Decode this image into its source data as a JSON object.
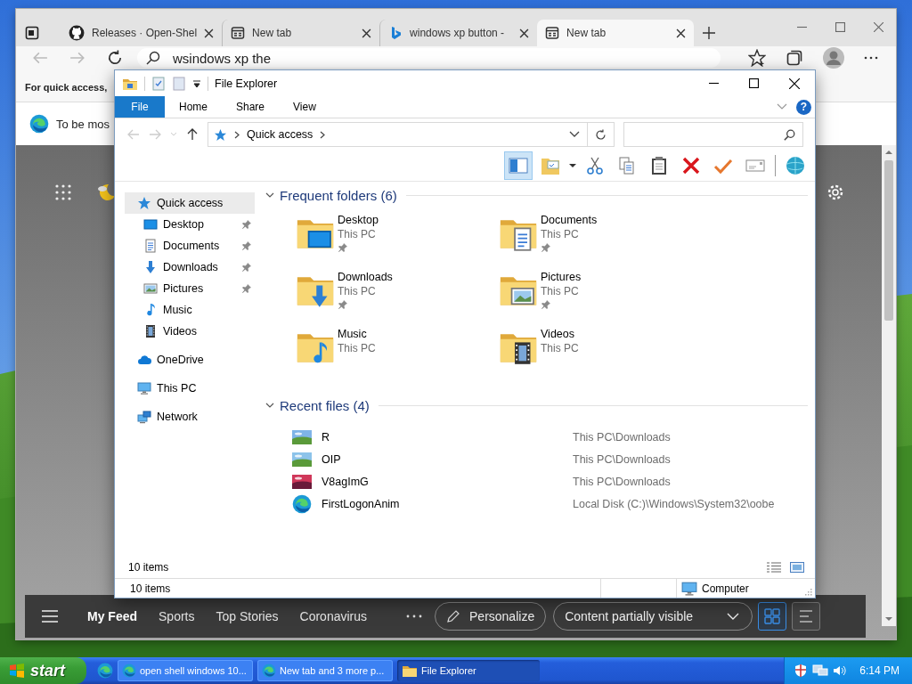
{
  "browser": {
    "tabs": [
      {
        "title": "Releases · Open-Shel",
        "kind": "github",
        "selected": false
      },
      {
        "title": "New tab",
        "kind": "page",
        "selected": false
      },
      {
        "title": "windows xp button -",
        "kind": "bing",
        "selected": false
      },
      {
        "title": "New tab",
        "kind": "page",
        "selected": true
      }
    ],
    "address": "wsindows xp the",
    "favorites_bar": "For quick access,",
    "notification": "To be mos",
    "feed_tabs": [
      {
        "label": "My Feed",
        "selected": true
      },
      {
        "label": "Sports",
        "selected": false
      },
      {
        "label": "Top Stories",
        "selected": false
      },
      {
        "label": "Coronavirus",
        "selected": false
      }
    ],
    "personalize": "Personalize",
    "content_filter": "Content partially visible",
    "layout_buttons": [
      {
        "kind": "grid",
        "selected": true
      },
      {
        "kind": "list",
        "selected": false
      }
    ]
  },
  "explorer": {
    "title": "File Explorer",
    "ribbon_tabs": [
      {
        "label": "File",
        "selected": true
      },
      {
        "label": "Home",
        "selected": false
      },
      {
        "label": "Share",
        "selected": false
      },
      {
        "label": "View",
        "selected": false
      }
    ],
    "help": "?",
    "breadcrumb": "Quick access",
    "toolbar": [
      {
        "kind": "pane",
        "selected": true
      },
      {
        "kind": "folder",
        "selected": false
      },
      {
        "kind": "caret",
        "selected": false
      },
      {
        "kind": "cut",
        "selected": false
      },
      {
        "kind": "copy",
        "selected": false
      },
      {
        "kind": "paste",
        "selected": false
      },
      {
        "kind": "delete",
        "selected": false
      },
      {
        "kind": "rename",
        "selected": false
      },
      {
        "kind": "mail",
        "selected": false
      },
      {
        "kind": "globe",
        "selected": false
      }
    ],
    "nav": [
      {
        "label": "Quick access",
        "kind": "star",
        "selected": true,
        "children": [
          {
            "label": "Desktop",
            "kind": "desktop",
            "pinned": true,
            "selected": false
          },
          {
            "label": "Documents",
            "kind": "documents",
            "pinned": true,
            "selected": false
          },
          {
            "label": "Downloads",
            "kind": "downloads",
            "pinned": true,
            "selected": false
          },
          {
            "label": "Pictures",
            "kind": "pictures",
            "pinned": true,
            "selected": false
          },
          {
            "label": "Music",
            "kind": "music",
            "pinned": false,
            "selected": false
          },
          {
            "label": "Videos",
            "kind": "videos",
            "pinned": false,
            "selected": false
          }
        ]
      },
      {
        "label": "OneDrive",
        "kind": "cloud",
        "selected": false
      },
      {
        "label": "This PC",
        "kind": "pc",
        "selected": false
      },
      {
        "label": "Network",
        "kind": "network",
        "selected": false
      }
    ],
    "frequent": {
      "heading": "Frequent folders (6)",
      "expanded": true,
      "folders": [
        {
          "name": "Desktop",
          "kind": "desktop",
          "location": "This PC",
          "pinned": true
        },
        {
          "name": "Documents",
          "kind": "documents",
          "location": "This PC",
          "pinned": true
        },
        {
          "name": "Downloads",
          "kind": "downloads",
          "location": "This PC",
          "pinned": true
        },
        {
          "name": "Pictures",
          "kind": "pictures",
          "location": "This PC",
          "pinned": true
        },
        {
          "name": "Music",
          "kind": "music",
          "location": "This PC",
          "pinned": false
        },
        {
          "name": "Videos",
          "kind": "videos",
          "location": "This PC",
          "pinned": false
        }
      ]
    },
    "recent": {
      "heading": "Recent files (4)",
      "expanded": true,
      "files": [
        {
          "name": "R",
          "kind": "picture",
          "path": "This PC\\Downloads"
        },
        {
          "name": "OIP",
          "kind": "picture",
          "path": "This PC\\Downloads"
        },
        {
          "name": "V8agImG",
          "kind": "picture",
          "path": "This PC\\Downloads"
        },
        {
          "name": "FirstLogonAnim",
          "kind": "edge",
          "path": "Local Disk (C:)\\Windows\\System32\\oobe"
        }
      ]
    },
    "item_count": "10 items",
    "status": {
      "count": "10 items",
      "location": "Computer"
    }
  },
  "taskbar": {
    "start": "start",
    "tasks": [
      {
        "label": "open shell windows 10...",
        "kind": "edge",
        "selected": false
      },
      {
        "label": "New tab and 3 more p...",
        "kind": "edge",
        "selected": false
      },
      {
        "label": "File Explorer",
        "kind": "folder",
        "selected": true
      }
    ],
    "clock": "6:14 PM"
  }
}
